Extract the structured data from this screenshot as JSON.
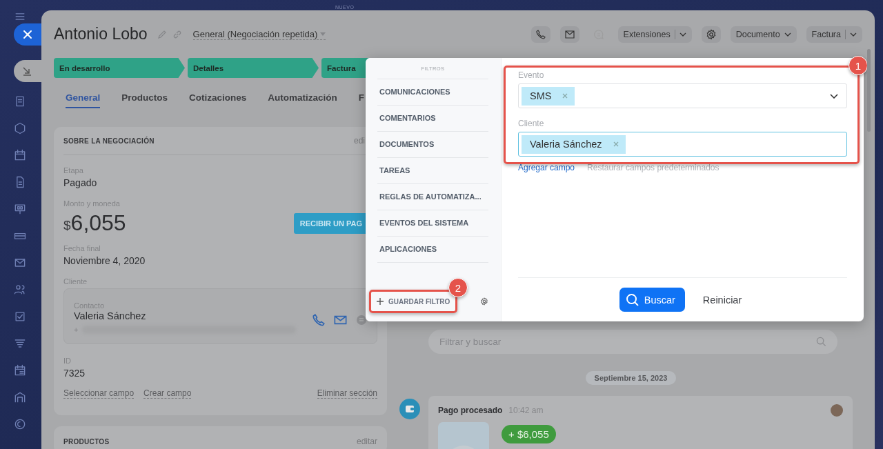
{
  "top_label": "NUEVO",
  "header": {
    "title": "Antonio Lobo",
    "pipeline": "General (Negociación repetida)",
    "icon_buttons": [
      {
        "disabled": false
      },
      {
        "disabled": false
      },
      {
        "disabled": true
      }
    ],
    "extensions": "Extensiones",
    "document": "Documento",
    "invoice": "Factura"
  },
  "stages": [
    {
      "label": "En desarrollo"
    },
    {
      "label": "Detalles"
    },
    {
      "label": "Factura"
    }
  ],
  "tabs": [
    {
      "label": "General",
      "selected": true
    },
    {
      "label": "Productos",
      "selected": false
    },
    {
      "label": "Cotizaciones",
      "selected": false
    },
    {
      "label": "Automatización",
      "selected": false
    },
    {
      "label": "F",
      "selected": false
    }
  ],
  "deal_card": {
    "title": "SOBRE LA NEGOCIACIÓN",
    "edit": "edi",
    "stage_label": "Etapa",
    "stage_value": "Pagado",
    "amount_label": "Monto y moneda",
    "currency": "$",
    "amount": "6,055",
    "pay_button": "RECIBIR UN PAG",
    "date_label": "Fecha final",
    "date_value": "Noviembre 4, 2020",
    "client_label": "Cliente",
    "contact_label": "Contacto",
    "contact_name": "Valeria Sánchez",
    "phone_prefix": "+",
    "id_label": "ID",
    "id_value": "7325",
    "links": [
      "Seleccionar campo",
      "Crear campo"
    ],
    "delete_link": "Eliminar sección"
  },
  "products_card": {
    "title": "PRODUCTOS",
    "edit": "editar"
  },
  "timeline": {
    "search_placeholder": "Filtrar y buscar",
    "date": "Septiembre 15, 2023",
    "entry_title": "Pago procesado",
    "entry_time": "10:42 am",
    "entry_amount": "+ $6,055"
  },
  "filter": {
    "heading": "FILTROS",
    "sections": [
      "COMUNICACIONES",
      "COMENTARIOS",
      "DOCUMENTOS",
      "TAREAS",
      "REGLAS DE AUTOMATIZA...",
      "EVENTOS DEL SISTEMA",
      "APLICACIONES"
    ],
    "save": "GUARDAR FILTRO",
    "fields": [
      {
        "label": "Evento",
        "kind": "select",
        "focused": false,
        "tags": [
          "SMS"
        ]
      },
      {
        "label": "Cliente",
        "kind": "entity",
        "focused": true,
        "tags": [
          "Valeria Sánchez"
        ]
      }
    ],
    "add_field": "Agregar campo",
    "restore": "Restaurar campos predeterminados",
    "search_button": "Buscar",
    "reset": "Reiniciar"
  },
  "annotations": [
    {
      "number": "1"
    },
    {
      "number": "2"
    }
  ]
}
